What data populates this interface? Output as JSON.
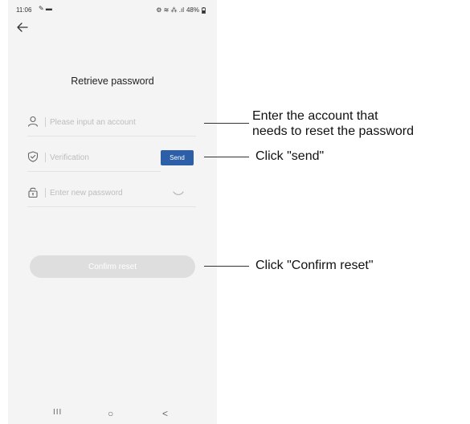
{
  "status_bar": {
    "time": "11:06",
    "msg_icons": "✎ ▬",
    "right_icons": "⚙ ≋ ⁂ .ıl",
    "battery": "48%"
  },
  "page": {
    "title": "Retrieve password"
  },
  "form": {
    "account_placeholder": "Please input an account",
    "verification_placeholder": "Verification",
    "send_label": "Send",
    "password_placeholder": "Enter new password",
    "confirm_label": "Confirm reset"
  },
  "annotations": {
    "account_line1": "Enter the account that",
    "account_line2": "needs to reset the password",
    "send_note": "Click \"send\"",
    "confirm_note": "Click \"Confirm reset\""
  },
  "nav": {
    "recents_glyph": "III",
    "home_glyph": "○",
    "back_glyph": "<"
  },
  "colors": {
    "accent": "#2c5fa8",
    "confirm_disabled": "#dedede",
    "screen_bg": "#f4f4f4"
  }
}
